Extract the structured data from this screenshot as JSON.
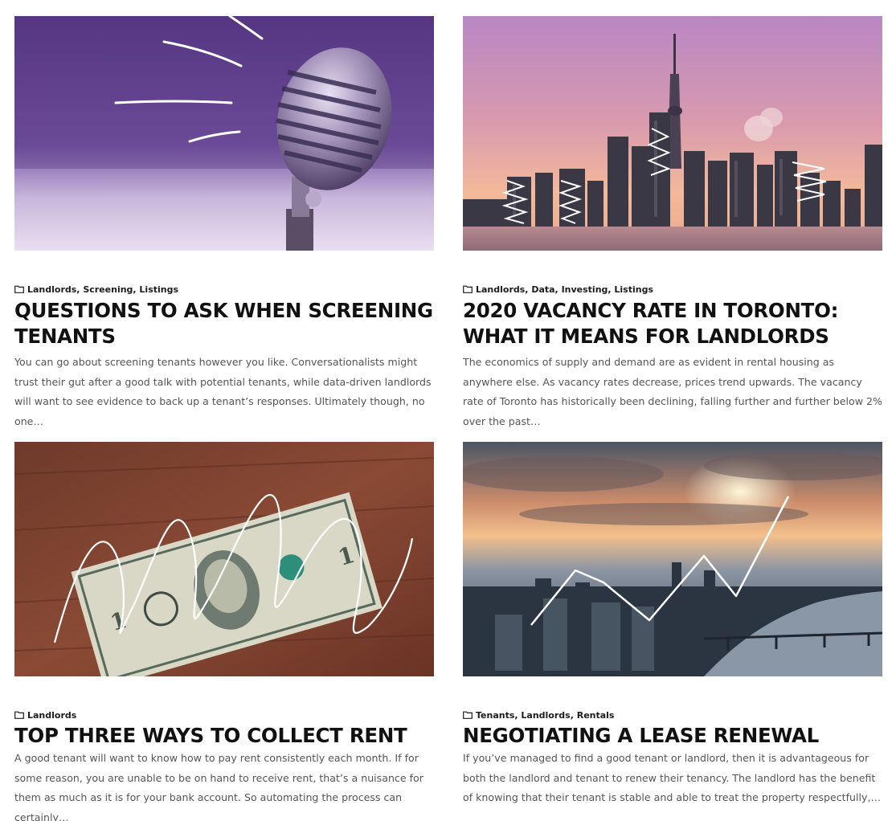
{
  "posts": [
    {
      "image": "microphone-photo",
      "categories": "Landlords, Screening, Listings",
      "title": "QUESTIONS TO ASK WHEN SCREENING TENANTS",
      "excerpt": "You can go about screening tenants however you like. Conversationalists might trust their gut after a good talk with potential tenants, while data-driven landlords will want to see evidence to back up a tenant’s responses. Ultimately though, no one…"
    },
    {
      "image": "toronto-skyline-photo",
      "categories": "Landlords, Data, Investing, Listings",
      "title": "2020 VACANCY RATE IN TORONTO: WHAT IT MEANS FOR LANDLORDS",
      "excerpt": "The economics of supply and demand are as evident in rental housing as anywhere else. As vacancy rates decrease, prices trend upwards. The vacancy rate of Toronto has historically been declining, falling further and further below 2% over the past…"
    },
    {
      "image": "dollar-bill-photo",
      "categories": "Landlords",
      "title": "TOP THREE WAYS TO COLLECT RENT",
      "excerpt": "A good tenant will want to know how to pay rent consistently each month. If for some reason, you are unable to be on hand to receive rent, that’s a nuisance for them as much as it is for your bank account. So automating the process can certainly…"
    },
    {
      "image": "city-sunrise-photo",
      "categories": "Tenants, Landlords, Rentals",
      "title": "NEGOTIATING A LEASE RENEWAL",
      "excerpt": "If you’ve managed to find a good tenant or landlord, then it is advantageous for both the landlord and tenant to renew their tenancy. The landlord has the benefit of knowing that their tenant is stable and able to treat the property respectfully,…"
    }
  ]
}
